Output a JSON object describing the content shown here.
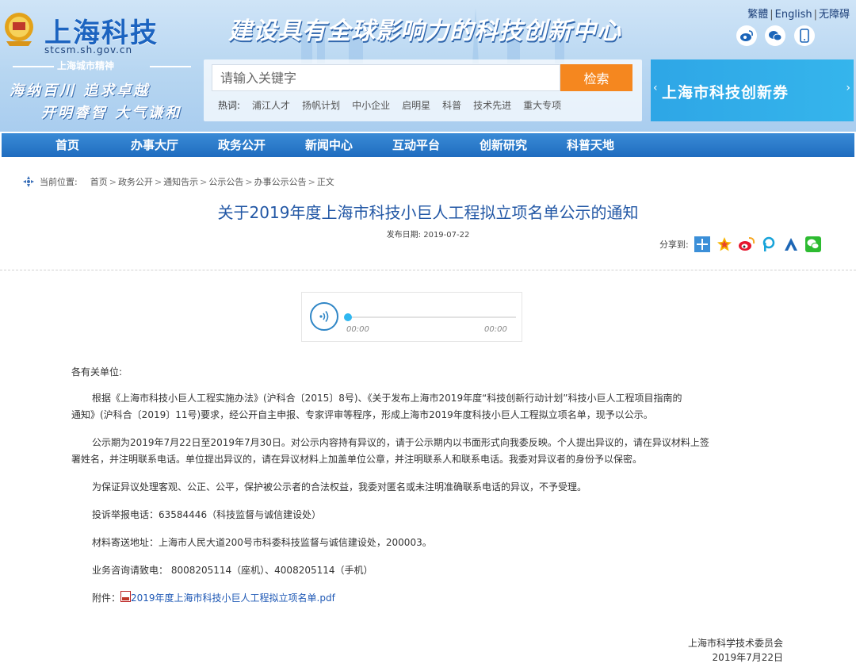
{
  "header": {
    "site_name": "上海科技",
    "domain": "stcsm.sh.gov.cn",
    "spirit_title": "上海城市精神",
    "motto_line1": "海纳百川  追求卓越",
    "motto_line2": "开明睿智  大气谦和",
    "slogan": "建设具有全球影响力的科技创新中心",
    "lang": {
      "traditional": "繁體",
      "english": "English",
      "accessibility": "无障碍"
    },
    "social_icons": [
      "weibo-icon",
      "wechat-icon",
      "mobile-icon"
    ],
    "search": {
      "placeholder": "请输入关键字",
      "button_label": "检索",
      "hot_label": "热词:",
      "hot_words": [
        "浦江人才",
        "扬帆计划",
        "中小企业",
        "启明星",
        "科普",
        "技术先进",
        "重大专项"
      ]
    },
    "banner_right": "上海市科技创新券"
  },
  "nav": [
    "首页",
    "办事大厅",
    "政务公开",
    "新闻中心",
    "互动平台",
    "创新研究",
    "科普天地"
  ],
  "breadcrumb": {
    "label": "当前位置:",
    "items": [
      "首页",
      "政务公开",
      "通知告示",
      "公示公告",
      "办事公示公告",
      "正文"
    ]
  },
  "article": {
    "title": "关于2019年度上海市科技小巨人工程拟立项名单公示的通知",
    "date_label": "发布日期:",
    "date": "2019-07-22",
    "share_label": "分享到:"
  },
  "audio": {
    "current": "00:00",
    "total": "00:00",
    "progress": 0
  },
  "content": {
    "salutation": "各有关单位:",
    "p1_line1": "根据《上海市科技小巨人工程实施办法》(沪科合〔2015〕8号)、《关于发布上海市2019年度“科技创新行动计划”科技小巨人工程项目指南的",
    "p1_line2": "通知》(沪科合〔2019〕11号)要求，经公开自主申报、专家评审等程序，形成上海市2019年度科技小巨人工程拟立项名单，现予以公示。",
    "p2_line1": "公示期为2019年7月22日至2019年7月30日。对公示内容持有异议的，请于公示期内以书面形式向我委反映。个人提出异议的，请在异议材料上签",
    "p2_line2": "署姓名，并注明联系电话。单位提出异议的，请在异议材料上加盖单位公章，并注明联系人和联系电话。我委对异议者的身份予以保密。",
    "p3": "为保证异议处理客观、公正、公平，保护被公示者的合法权益，我委对匿名或未注明准确联系电话的异议，不予受理。",
    "p4": "投诉举报电话：63584446（科技监督与诚信建设处）",
    "p5": "材料寄送地址：上海市人民大道200号市科委科技监督与诚信建设处，200003。",
    "p6": "业务咨询请致电： 8008205114（座机）、4008205114（手机）",
    "attachment_label": "附件：",
    "attachment_link": "2019年度上海市科技小巨人工程拟立项名单.pdf"
  },
  "signature": {
    "org": "上海市科学技术委员会",
    "date": "2019年7月22日"
  },
  "colors": {
    "nav_blue": "#2a7bcf",
    "title_blue": "#2257a5",
    "search_orange": "#f5871f",
    "banner_cyan": "#2ea6e6"
  }
}
